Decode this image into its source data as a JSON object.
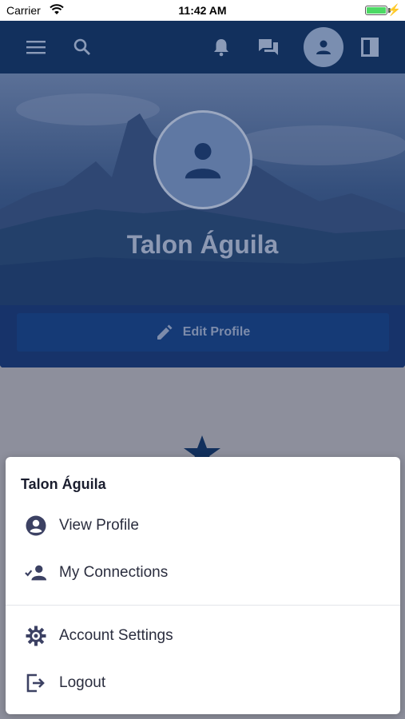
{
  "status_bar": {
    "carrier": "Carrier",
    "time": "11:42 AM"
  },
  "navbar": {
    "icons": [
      "menu-icon",
      "search-icon",
      "bell-icon",
      "chat-icon",
      "account-icon",
      "sidebar-icon"
    ]
  },
  "profile": {
    "name": "Talon Águila",
    "edit_label": "Edit Profile"
  },
  "menu": {
    "title": "Talon Águila",
    "items": [
      {
        "label": "View Profile",
        "icon": "account-circle-icon"
      },
      {
        "label": "My Connections",
        "icon": "connections-icon"
      },
      {
        "label": "Account Settings",
        "icon": "settings-gear-icon"
      },
      {
        "label": "Logout",
        "icon": "logout-icon"
      }
    ]
  },
  "colors": {
    "navbar": "#12305d",
    "accent": "#153a76",
    "menu_text": "#2a2d3e",
    "icon": "#3c4163"
  }
}
